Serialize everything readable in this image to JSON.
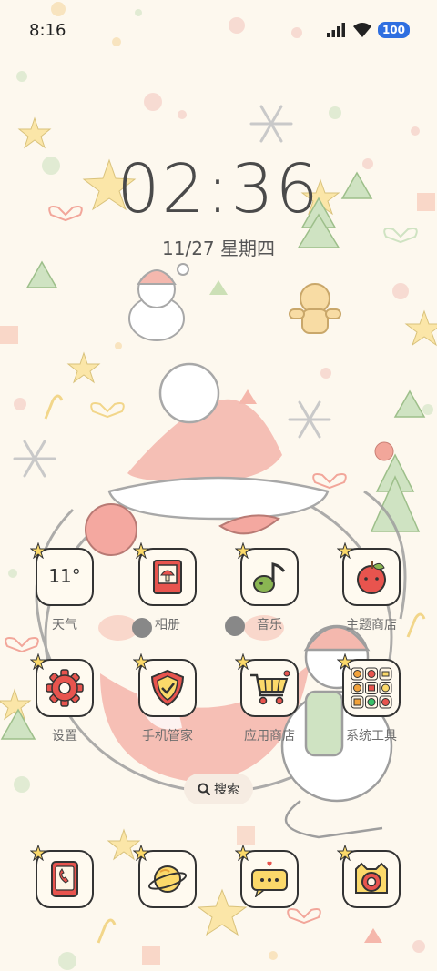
{
  "status_bar": {
    "time": "8:16",
    "battery": "100",
    "icons": [
      "signal-icon",
      "wifi-icon",
      "battery-icon"
    ]
  },
  "lockclock": {
    "time": "02:36",
    "date": "11/27 星期四"
  },
  "apps": [
    {
      "label": "天气",
      "icon": "weather-icon",
      "temp": "11°"
    },
    {
      "label": "相册",
      "icon": "gallery-icon"
    },
    {
      "label": "音乐",
      "icon": "music-icon"
    },
    {
      "label": "主题商店",
      "icon": "theme-store-icon"
    },
    {
      "label": "设置",
      "icon": "settings-gear-icon"
    },
    {
      "label": "手机管家",
      "icon": "security-shield-icon"
    },
    {
      "label": "应用商店",
      "icon": "app-store-cart-icon"
    },
    {
      "label": "系统工具",
      "icon": "system-tools-folder-icon"
    }
  ],
  "dock": [
    {
      "icon": "phone-icon"
    },
    {
      "icon": "browser-planet-icon"
    },
    {
      "icon": "messages-icon"
    },
    {
      "icon": "camera-icon"
    }
  ],
  "search": {
    "label": "搜索",
    "icon": "search-icon"
  },
  "colors": {
    "background": "#fdf8ee",
    "accent_red": "#e8544e",
    "battery_blue": "#2f6fe0"
  }
}
